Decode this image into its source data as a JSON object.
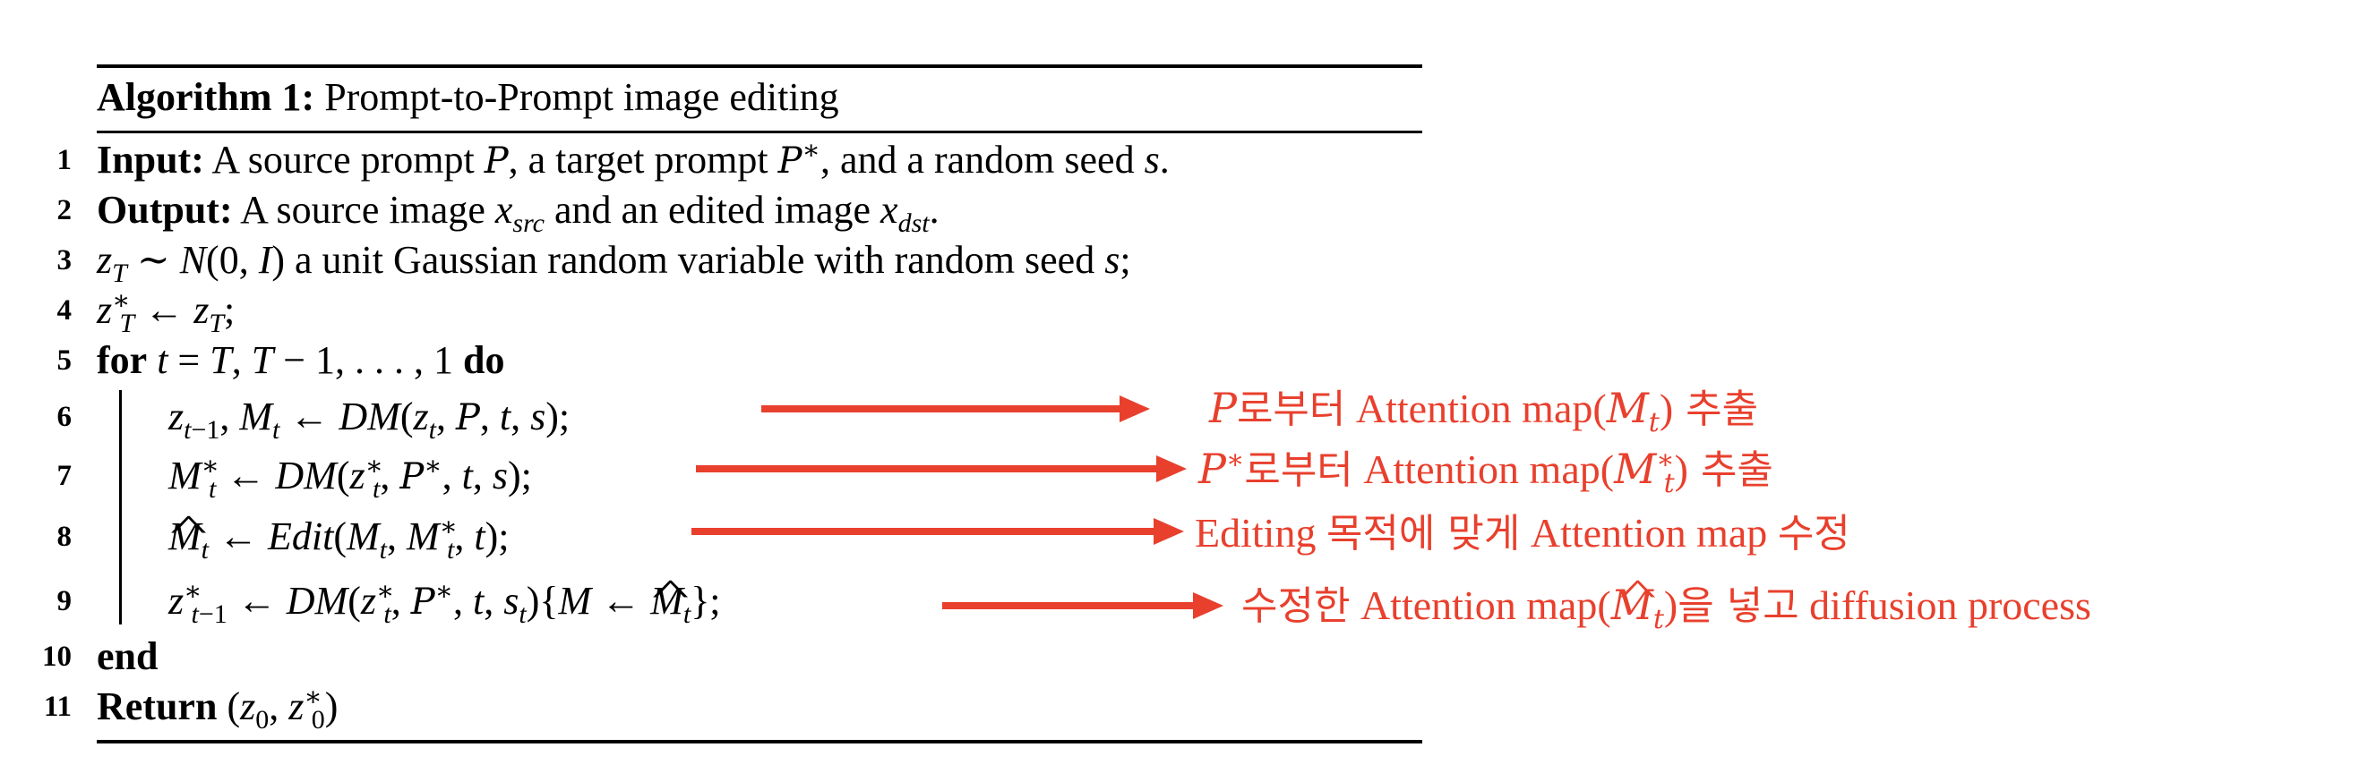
{
  "algorithm": {
    "caption_label": "Algorithm 1:",
    "caption_title": "Prompt-to-Prompt image editing",
    "line_numbers": [
      "1",
      "2",
      "3",
      "4",
      "5",
      "6",
      "7",
      "8",
      "9",
      "10",
      "11"
    ],
    "kw_input": "Input:",
    "input_text_a": " A source prompt ",
    "input_text_b": ", a target prompt ",
    "input_text_c": ", and a random seed ",
    "kw_output": "Output:",
    "output_text_a": " A source image ",
    "output_text_b": " and an edited image ",
    "line3_text": " a unit Gaussian random variable with random seed ",
    "kw_for": "for",
    "kw_do": "do",
    "kw_end": "end",
    "kw_return": "Return"
  },
  "annotations": {
    "note1_kr_a": "로부터",
    "note1_text": " Attention map(",
    "note1_kr_b": " 추출",
    "note2_kr_a": "로부터",
    "note2_text": " Attention map(",
    "note2_kr_b": " 추출",
    "note3_text_a": "Editing ",
    "note3_kr_a": "목적에 맞게",
    "note3_text_b": " Attention map ",
    "note3_kr_b": "수정",
    "note4_kr_a": "수정한",
    "note4_text_a": " Attention map(",
    "note4_kr_b": "을 넣고",
    "note4_text_b": " diffusion process"
  },
  "colors": {
    "annotation": "#e8402d",
    "text": "#000000"
  }
}
